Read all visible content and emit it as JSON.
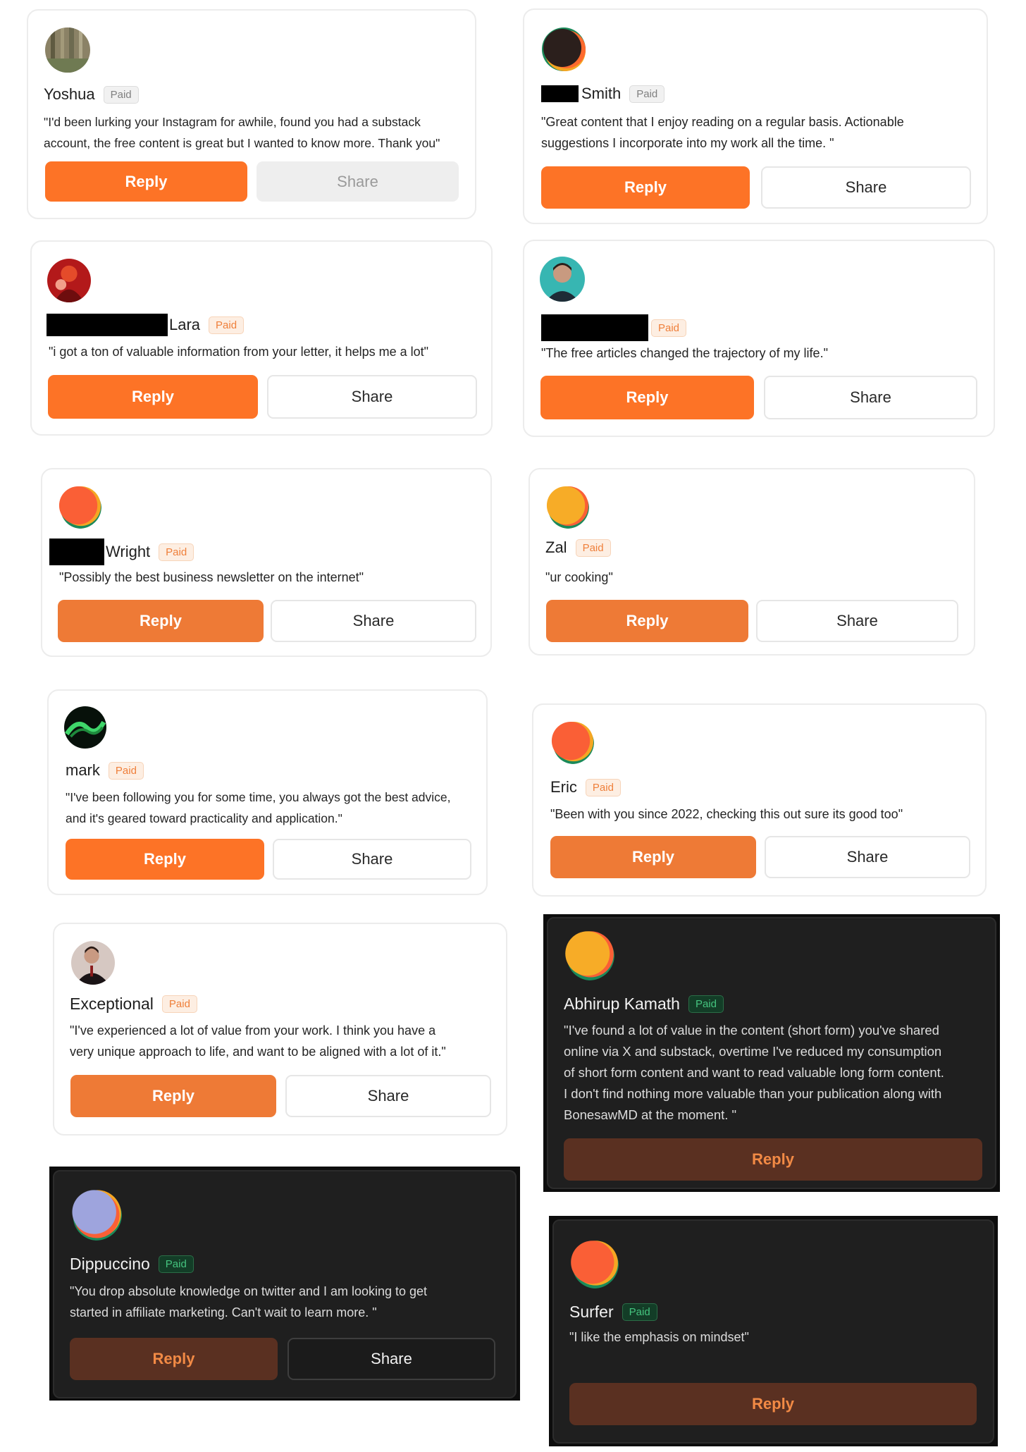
{
  "labels": {
    "paid": "Paid",
    "reply": "Reply",
    "share": "Share"
  },
  "cards": [
    {
      "name": "Yoshua",
      "quote_lines": [
        "\"I'd been lurking your Instagram for awhile, found you had a substack",
        "account, the free content is great but I wanted to know more. Thank you\""
      ],
      "avatar_icon": "forest-photo-avatar-icon"
    },
    {
      "name": "Smith",
      "quote_lines": [
        "\"Great content that I enjoy reading on a regular basis. Actionable",
        "suggestions I incorporate into my work all the time. \""
      ],
      "avatar_icon": "dark-blob-avatar-icon"
    },
    {
      "name": "Lara",
      "quote_lines": [
        "\"i got a ton of valuable information from your letter, it helps me a lot\""
      ],
      "avatar_icon": "red-figure-photo-avatar-icon"
    },
    {
      "name": "",
      "quote_lines": [
        "\"The free articles changed the trajectory of my life.\""
      ],
      "avatar_icon": "portrait-photo-avatar-icon"
    },
    {
      "name": "Wright",
      "quote_lines": [
        "\"Possibly the best business newsletter on the internet\""
      ],
      "avatar_icon": "orange-blob-avatar-icon"
    },
    {
      "name": "Zal",
      "quote_lines": [
        "\"ur cooking\""
      ],
      "avatar_icon": "yellow-blob-avatar-icon"
    },
    {
      "name": "mark",
      "quote_lines": [
        "\"I've been following you for some time, you always got the best advice,",
        "and it's geared toward practicality and application.\""
      ],
      "avatar_icon": "green-wave-avatar-icon"
    },
    {
      "name": "Eric",
      "quote_lines": [
        "\"Been with you since 2022, checking this out sure its good too\""
      ],
      "avatar_icon": "orange-blob-avatar-icon"
    },
    {
      "name": "Exceptional",
      "quote_lines": [
        "\"I've experienced a lot of value from your work. I think you have a",
        "very unique approach to life, and want to be aligned with a lot of it.\""
      ],
      "avatar_icon": "suit-person-photo-avatar-icon"
    },
    {
      "name": "Abhirup Kamath",
      "quote_lines": [
        "\"I've found a lot of value in the content (short form) you've shared",
        "online via X and substack, overtime I've reduced my consumption",
        "of short form content and want to read valuable long form content.",
        "I don't find nothing more valuable than your publication along with",
        "BonesawMD at the moment. \""
      ],
      "avatar_icon": "yellow-blob-avatar-icon"
    },
    {
      "name": "Dippuccino",
      "quote_lines": [
        "\"You drop absolute knowledge on twitter and I am looking to get",
        "started in affiliate marketing. Can't wait to learn more. \""
      ],
      "avatar_icon": "lavender-blob-avatar-icon"
    },
    {
      "name": "Surfer",
      "quote_lines": [
        "\"I like the emphasis on mindset\""
      ],
      "avatar_icon": "orange-blob-avatar-icon"
    }
  ],
  "colors": {
    "accent": "#fd7326",
    "paid_badge": "#ef7f3a",
    "dark_bg": "#1f1f1f"
  }
}
